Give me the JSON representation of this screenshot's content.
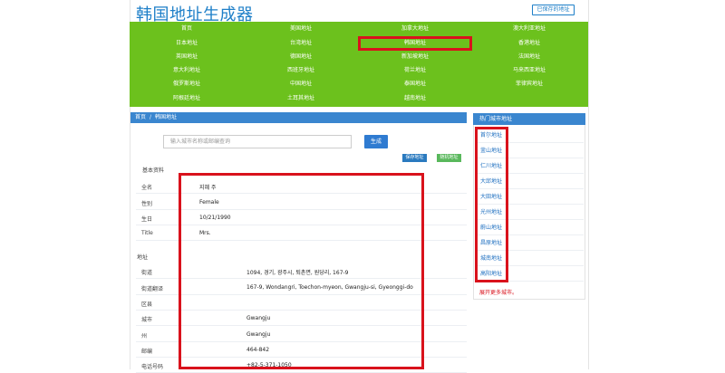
{
  "header": {
    "title": "韩国地址生成器",
    "saved_link": "已保存的地址"
  },
  "nav": {
    "items": [
      "首页",
      "美国地址",
      "加拿大地址",
      "澳大利亚地址",
      "日本地址",
      "台湾地址",
      "韩国地址",
      "香港地址",
      "英国地址",
      "德国地址",
      "新加坡地址",
      "法国地址",
      "意大利地址",
      "西班牙地址",
      "荷兰地址",
      "马来西亚地址",
      "俄罗斯地址",
      "中国地址",
      "泰国地址",
      "菲律宾地址",
      "阿根廷地址",
      "土耳其地址",
      "越南地址"
    ],
    "active": "韩国地址"
  },
  "breadcrumb": {
    "home": "首页",
    "separator": "/",
    "current": "韩国地址"
  },
  "search": {
    "placeholder": "输入城市名称或邮编查询",
    "button": "生成"
  },
  "actions": {
    "save": "保存地址",
    "random": "随机地址"
  },
  "basic": {
    "section": "基本资料",
    "rows": [
      {
        "label": "全名",
        "value": "지혜 주"
      },
      {
        "label": "性别",
        "value": "Female"
      },
      {
        "label": "生日",
        "value": "10/21/1990"
      },
      {
        "label": "Title",
        "value": "Mrs."
      }
    ]
  },
  "address": {
    "section": "地址",
    "rows": [
      {
        "label": "街道",
        "value": "1094, 경기, 광주시, 퇴촌면, 원당리, 167-9"
      },
      {
        "label": "街道翻译",
        "value": "167-9, Wondangri, Toechon-myeon, Gwangju-si, Gyeonggi-do"
      },
      {
        "label": "区县",
        "value": ""
      },
      {
        "label": "城市",
        "value": "Gwangju"
      },
      {
        "label": "州",
        "value": "Gwangju"
      },
      {
        "label": "邮编",
        "value": "464-842"
      },
      {
        "label": "电话号码",
        "value": "+82-5-371-1050"
      }
    ]
  },
  "hot_cities": {
    "title": "热门城市地址",
    "items": [
      "首尔地址",
      "釜山地址",
      "仁川地址",
      "大邱地址",
      "大田地址",
      "光州地址",
      "蔚山地址",
      "昌原地址",
      "城南地址",
      "高阳地址"
    ],
    "more": "展开更多城市。"
  },
  "colors": {
    "brand_blue": "#1e7fc8",
    "nav_green": "#6cc11d",
    "highlight_red": "#d9121c"
  }
}
